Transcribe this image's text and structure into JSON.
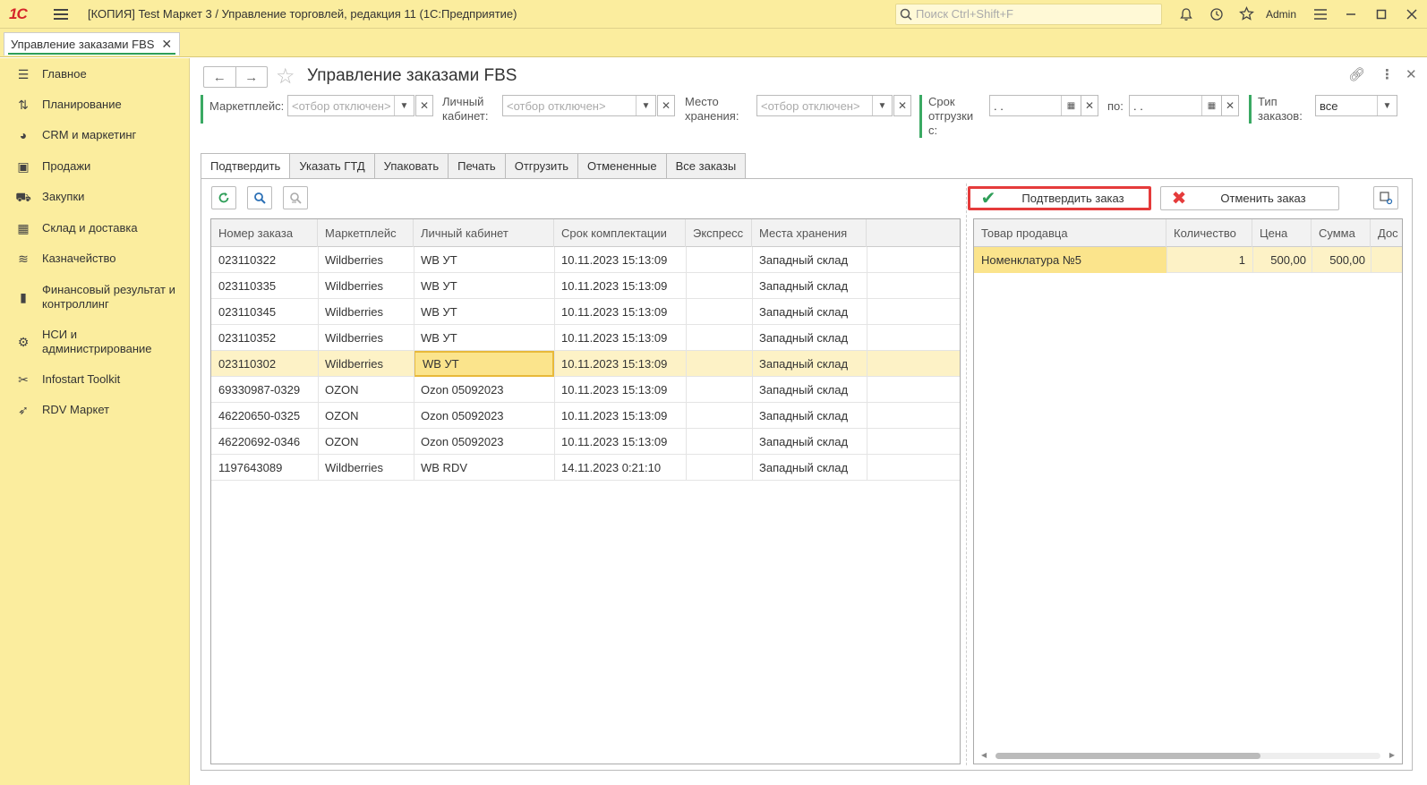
{
  "app": {
    "logo": "1С",
    "title": "[КОПИЯ] Test Маркет 3 / Управление торговлей, редакция 11  (1С:Предприятие)",
    "search_placeholder": "Поиск Ctrl+Shift+F",
    "user": "Admin"
  },
  "open_tab": {
    "label": "Управление заказами FBS"
  },
  "sidebar": {
    "items": [
      {
        "label": "Главное",
        "icon": "menu-lines-icon"
      },
      {
        "label": "Планирование",
        "icon": "planning-icon"
      },
      {
        "label": "CRM и маркетинг",
        "icon": "pie-chart-icon"
      },
      {
        "label": "Продажи",
        "icon": "shopping-bag-icon"
      },
      {
        "label": "Закупки",
        "icon": "cart-icon"
      },
      {
        "label": "Склад и доставка",
        "icon": "grid-icon"
      },
      {
        "label": "Казначейство",
        "icon": "coins-icon"
      },
      {
        "label": "Финансовый результат и контроллинг",
        "icon": "bar-chart-icon"
      },
      {
        "label": "НСИ и администрирование",
        "icon": "gear-icon"
      },
      {
        "label": "Infostart Toolkit",
        "icon": "tools-icon"
      },
      {
        "label": "RDV Маркет",
        "icon": "rocket-icon"
      }
    ]
  },
  "page": {
    "title": "Управление заказами FBS"
  },
  "filters": {
    "marketplace_label": "Маркетплейс:",
    "marketplace_value": "<отбор отключен>",
    "cabinet_label": "Личный кабинет:",
    "cabinet_value": "<отбор отключен>",
    "storage_label": "Место хранения:",
    "storage_value": "<отбор отключен>",
    "ship_from_label": "Срок отгрузки с:",
    "ship_from_value": " .  .",
    "ship_to_label": "по:",
    "ship_to_value": " .  .",
    "order_type_label": "Тип заказов:",
    "order_type_value": "все"
  },
  "tabs": [
    "Подтвердить",
    "Указать ГТД",
    "Упаковать",
    "Печать",
    "Отгрузить",
    "Отмененные",
    "Все заказы"
  ],
  "actions": {
    "confirm": "Подтвердить заказ",
    "cancel": "Отменить заказ"
  },
  "orders_table": {
    "columns": [
      "Номер заказа",
      "Маркетплейс",
      "Личный кабинет",
      "Срок комплектации",
      "Экспресс",
      "Места хранения"
    ],
    "rows": [
      [
        "023110322",
        "Wildberries",
        "WB УТ",
        "10.11.2023 15:13:09",
        "",
        "Западный склад"
      ],
      [
        "023110335",
        "Wildberries",
        "WB УТ",
        "10.11.2023 15:13:09",
        "",
        "Западный склад"
      ],
      [
        "023110345",
        "Wildberries",
        "WB УТ",
        "10.11.2023 15:13:09",
        "",
        "Западный склад"
      ],
      [
        "023110352",
        "Wildberries",
        "WB УТ",
        "10.11.2023 15:13:09",
        "",
        "Западный склад"
      ],
      [
        "023110302",
        "Wildberries",
        "WB УТ",
        "10.11.2023 15:13:09",
        "",
        "Западный склад"
      ],
      [
        "69330987-0329",
        "OZON",
        "Ozon 05092023",
        "10.11.2023 15:13:09",
        "",
        "Западный склад"
      ],
      [
        "46220650-0325",
        "OZON",
        "Ozon 05092023",
        "10.11.2023 15:13:09",
        "",
        "Западный склад"
      ],
      [
        "46220692-0346",
        "OZON",
        "Ozon 05092023",
        "10.11.2023 15:13:09",
        "",
        "Западный склад"
      ],
      [
        "1197643089",
        "Wildberries",
        "WB RDV",
        "14.11.2023 0:21:10",
        "",
        "Западный склад"
      ]
    ]
  },
  "items_table": {
    "columns": [
      "Товар продавца",
      "Количество",
      "Цена",
      "Сумма",
      "Дос"
    ],
    "rows": [
      [
        "Номенклатура №5",
        "1",
        "500,00",
        "500,00",
        ""
      ]
    ]
  }
}
